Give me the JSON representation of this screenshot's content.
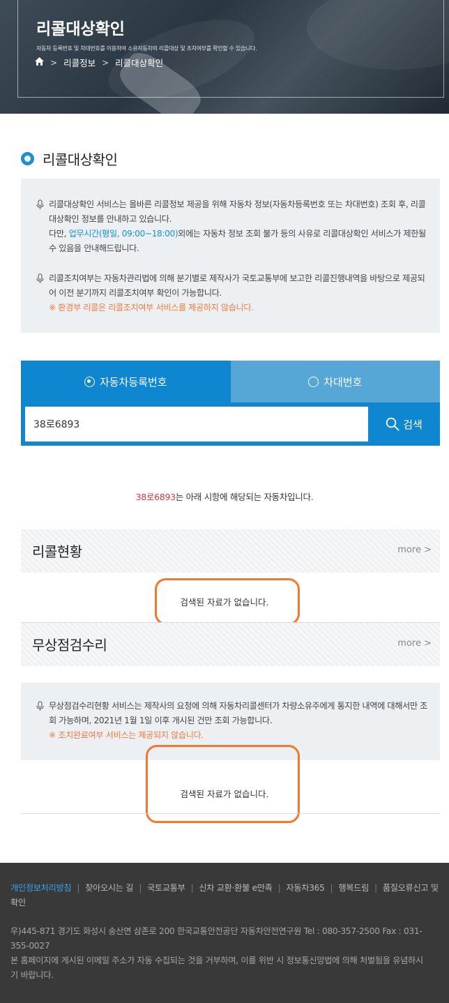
{
  "hero": {
    "title": "리콜대상확인",
    "desc": "자동차 등록번호 및 차대번호를 이용하여 소유자동차의 리콜대상 및 조치여부를 확인할 수 있습니다.",
    "breadcrumb": [
      "리콜정보",
      "리콜대상확인"
    ]
  },
  "section_title": "리콜대상확인",
  "notice1": {
    "item1_line1": "리콜대상확인 서비스는 올바른 리콜정보 제공을 위해 자동차 정보(자동차등록번호 또는 차대번호) 조회 후, 리콜대상확인 정보를 안내하고 있습니다.",
    "item1_pre": "다만, ",
    "item1_hours": "업무시간(평일, 09:00~18:00)",
    "item1_post": "외에는 자동차 정보 조회 불가 등의 사유로 리콜대상확인 서비스가 제한될 수 있음을 안내해드립니다.",
    "item2_text": "리콜조치여부는 자동차관리법에 의해 분기별로 제작사가 국토교통부에 보고한 리콜진행내역을 바탕으로 제공되어 이전 분기까지 리콜조치여부 확인이 가능합니다.",
    "item2_warn": "※ 환경부 리콜은 리콜조치여부 서비스를 제공하지 않습니다."
  },
  "tabs": {
    "registration": "자동차등록번호",
    "vin": "차대번호"
  },
  "search": {
    "value": "38로6893",
    "button": "검색"
  },
  "result": {
    "plate": "38로6893",
    "suffix": "는 아래 시항에 해당되는 자동차입니다."
  },
  "recall": {
    "title": "리콜현황",
    "more": "more >",
    "empty": "검색된 자료가 없습니다."
  },
  "repair": {
    "title": "무상점검수리",
    "more": "more >",
    "notice": "무상점검수리현황 서비스는 제작사의 요청에 의해 자동차리콜센터가 차량소유주에게 통지한 내역에 대해서만 조회 가능하며, 2021년 1월 1일 이후 개시된 건만 조회 가능합니다.",
    "warn": "※ 조치완료여부 서비스는 제공되지 않습니다.",
    "empty": "검색된 자료가 없습니다."
  },
  "footer": {
    "links": [
      "개인정보처리방침",
      "찾아오시는 길",
      "국토교통부",
      "신차 교환·환불 e만족",
      "자동차365",
      "행복드림",
      "품질오류신고 및 확인"
    ],
    "address": "우)445-871 경기도 화성시 송산면 삼존로 200 한국교통안전공단 자동차안전연구원 Tel : 080-357-2500 Fax : 031-355-0027",
    "email_notice": "본 홈페이지에 게시된 이메일 주소가 자동 수집되는 것을 거부하며, 이를 위반 시 정보통신망법에 의해 처벌됨을 유념하시기 바랍니다."
  },
  "colors": {
    "primary": "#0f87d0",
    "tab_inactive": "#56a7d5",
    "warn": "#f47b3f",
    "highlight": "#f5762c",
    "footer_bg": "#393939",
    "footer_link_active": "#37a4ea"
  }
}
